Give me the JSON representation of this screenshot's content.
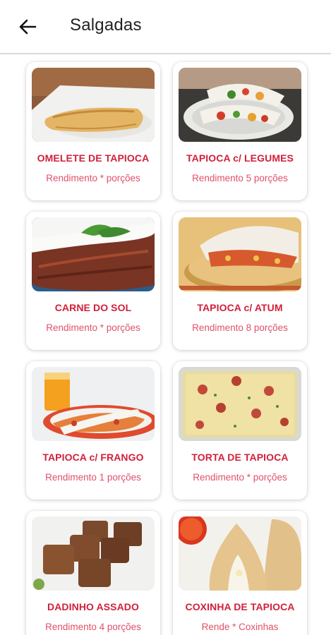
{
  "header": {
    "title": "Salgadas",
    "back_icon": "arrow-left-icon"
  },
  "colors": {
    "title_red": "#d0213a",
    "subtitle_red": "#e0506a"
  },
  "recipes": [
    {
      "title": "OMELETE DE TAPIOCA",
      "subtitle": "Rendimento * porções"
    },
    {
      "title": "TAPIOCA c/ LEGUMES",
      "subtitle": "Rendimento 5 porções"
    },
    {
      "title": "CARNE DO SOL",
      "subtitle": "Rendimento * porções"
    },
    {
      "title": "TAPIOCA c/ ATUM",
      "subtitle": "Rendimento 8 porções"
    },
    {
      "title": "TAPIOCA c/ FRANGO",
      "subtitle": "Rendimento 1 porções"
    },
    {
      "title": "TORTA DE TAPIOCA",
      "subtitle": "Rendimento * porções"
    },
    {
      "title": "DADINHO ASSADO",
      "subtitle": "Rendimento 4 porções"
    },
    {
      "title": "COXINHA DE TAPIOCA",
      "subtitle": "Rende * Coxinhas"
    }
  ]
}
